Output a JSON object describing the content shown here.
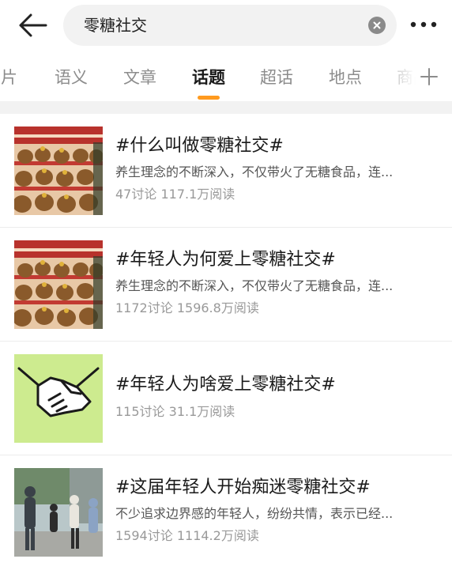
{
  "search": {
    "query": "零糖社交"
  },
  "icons": {
    "back": "arrow-left-icon",
    "clear": "clear-circle-icon",
    "more": "more-dots-icon",
    "add": "plus-icon"
  },
  "colors": {
    "accent": "#ff9a1f",
    "muted": "#999999"
  },
  "tabs": [
    {
      "label": "图片"
    },
    {
      "label": "语义"
    },
    {
      "label": "文章"
    },
    {
      "label": "话题",
      "active": true
    },
    {
      "label": "超话"
    },
    {
      "label": "地点"
    },
    {
      "label": "商品"
    }
  ],
  "topics": [
    {
      "title": "#什么叫做零糖社交#",
      "desc": "养生理念的不断深入，不仅带火了无糖食品，连...",
      "discussions": "47讨论",
      "reads": "117.1万阅读",
      "thumb": "capybara-plush-image"
    },
    {
      "title": "#年轻人为何爱上零糖社交#",
      "desc": "养生理念的不断深入，不仅带火了无糖食品，连...",
      "discussions": "1172讨论",
      "reads": "1596.8万阅读",
      "thumb": "capybara-plush-image"
    },
    {
      "title": "#年轻人为啥爱上零糖社交#",
      "desc": "",
      "discussions": "115讨论",
      "reads": "31.1万阅读",
      "thumb": "handshake-image"
    },
    {
      "title": "#这届年轻人开始痴迷零糖社交#",
      "desc": "不少追求边界感的年轻人，纷纷共情，表示已经...",
      "discussions": "1594讨论",
      "reads": "1114.2万阅读",
      "thumb": "people-walking-photo"
    }
  ]
}
